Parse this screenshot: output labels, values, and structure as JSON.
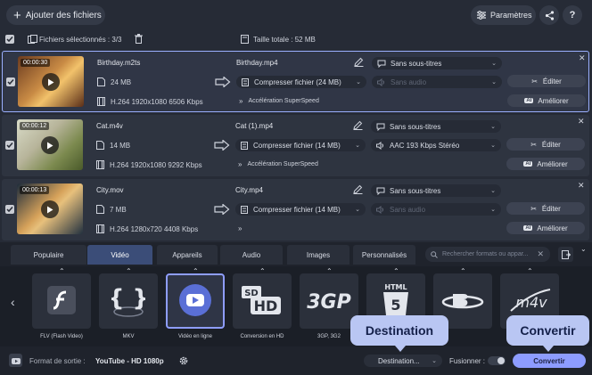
{
  "toolbar": {
    "add_files": "Ajouter des fichiers",
    "settings": "Paramètres",
    "help": "?"
  },
  "selection": {
    "selected": "Fichiers sélectionnés : 3/3",
    "total": "Taille totale : 52 MB"
  },
  "files": [
    {
      "duration": "00:00:30",
      "source_name": "Birthday.m2ts",
      "size": "24 MB",
      "codec": "H.264 1920x1080 6506 Kbps",
      "output_name": "Birthday.mp4",
      "compress": "Compresser fichier (24 MB)",
      "subtitles": "Sans sous-titres",
      "audio": "Sans audio",
      "audio_dim": true,
      "superspeed": "Accélération SuperSpeed",
      "edit": "Éditer",
      "enhance": "Améliorer"
    },
    {
      "duration": "00:00:12",
      "source_name": "Cat.m4v",
      "size": "14 MB",
      "codec": "H.264 1920x1080 9292 Kbps",
      "output_name": "Cat (1).mp4",
      "compress": "Compresser fichier (14 MB)",
      "subtitles": "Sans sous-titres",
      "audio": "AAC 193 Kbps Stéréo",
      "audio_dim": false,
      "superspeed": "Accélération SuperSpeed",
      "edit": "Éditer",
      "enhance": "Améliorer"
    },
    {
      "duration": "00:00:13",
      "source_name": "City.mov",
      "size": "7 MB",
      "codec": "H.264 1280x720 4408 Kbps",
      "output_name": "City.mp4",
      "compress": "Compresser fichier (14 MB)",
      "subtitles": "Sans sous-titres",
      "audio": "Sans audio",
      "audio_dim": true,
      "superspeed": "",
      "edit": "Éditer",
      "enhance": "Améliorer"
    }
  ],
  "tabs": [
    "Populaire",
    "Vidéo",
    "Appareils",
    "Audio",
    "Images",
    "Personnalisés"
  ],
  "active_tab": "Vidéo",
  "search_placeholder": "Rechercher formats ou appar...",
  "formats": [
    {
      "label": "FLV (Flash Video)",
      "icon": "flash-icon"
    },
    {
      "label": "MKV",
      "icon": "braces-icon"
    },
    {
      "label": "Vidéo en ligne",
      "icon": "youtube-icon",
      "selected": true
    },
    {
      "label": "Conversion en HD",
      "icon": "hd-icon",
      "badge": "HD"
    },
    {
      "label": "3GP, 3G2",
      "icon": "3gp-icon",
      "badge": "3GP"
    },
    {
      "label": "TS (MPEG2-TS)",
      "icon": "html5-icon",
      "badge": "HTML"
    },
    {
      "label": "",
      "icon": "bluray-icon"
    },
    {
      "label": "",
      "icon": "m4v-icon",
      "badge": "m4v"
    }
  ],
  "bottom": {
    "output_label": "Format de sortie :",
    "output_value": "YouTube - HD 1080p",
    "destination": "Destination...",
    "merge": "Fusionner :",
    "convert": "Convertir"
  },
  "callouts": {
    "destination": "Destination",
    "convert": "Convertir"
  },
  "colors": {
    "accent": "#8d9cff",
    "background": "#262b36",
    "callout": "#b9c6f3"
  }
}
